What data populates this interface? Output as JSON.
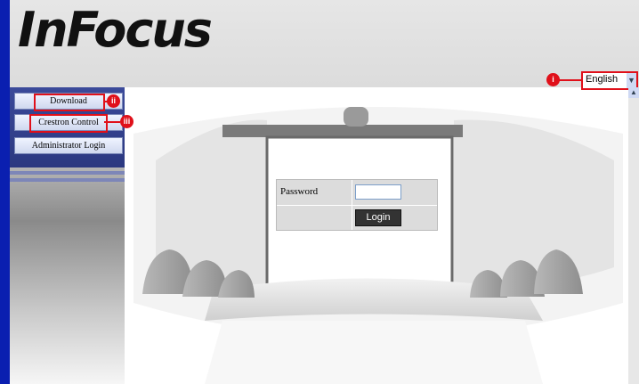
{
  "header": {
    "logo": "InFocus"
  },
  "language": {
    "selected": "English",
    "callout": "i"
  },
  "nav": {
    "items": [
      {
        "label": "Download",
        "callout": "ii"
      },
      {
        "label": "Crestron Control",
        "callout": "iii"
      },
      {
        "label": "Administrator Login"
      }
    ]
  },
  "login": {
    "password_label": "Password",
    "password_value": "",
    "button_label": "Login"
  },
  "colors": {
    "callout": "#e0101a",
    "nav_bg": "#2b3880",
    "left_edge": "#0a1fb0"
  }
}
